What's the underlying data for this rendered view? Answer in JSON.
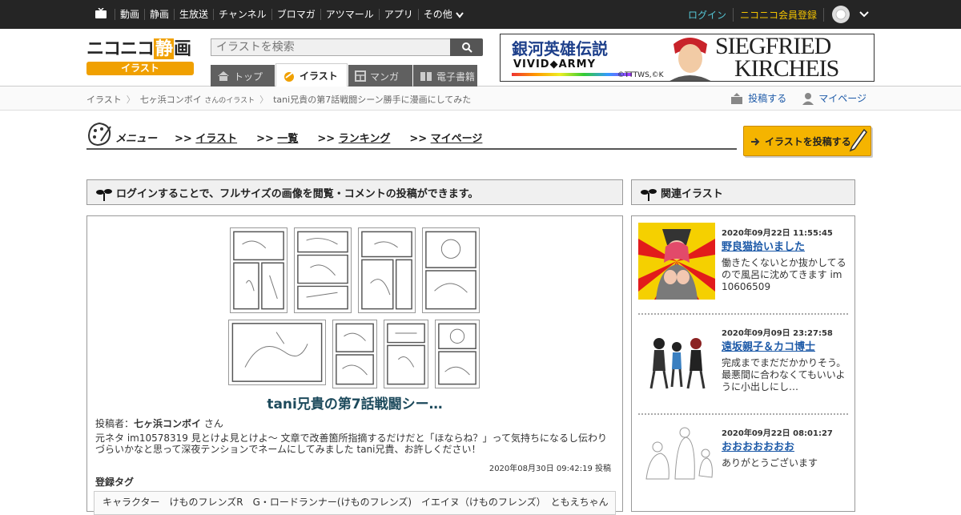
{
  "topbar": {
    "nav": [
      "動画",
      "静画",
      "生放送",
      "チャンネル",
      "ブロマガ",
      "アツマール",
      "アプリ",
      "その他"
    ],
    "login": "ログイン",
    "register": "ニコニコ会員登録"
  },
  "header": {
    "logo_main": "ニコニコ",
    "logo_sei": "静",
    "logo_ga": "画",
    "logo_sub": "イラスト",
    "search_placeholder": "イラストを検索",
    "tabs": [
      "トップ",
      "イラスト",
      "マンガ",
      "電子書籍"
    ],
    "banner": {
      "title": "銀河英雄伝説",
      "sub": "VIVID◆ARMY",
      "name1": "SIEGFRIED",
      "name2": "KIRCHEIS",
      "copy": "©TTTWS,©K"
    }
  },
  "breadcrumb": {
    "items": [
      "イラスト",
      "七ヶ浜コンボイ",
      "tani兄貴の第7話戦闘シーン勝手に漫画にしてみた"
    ],
    "author_suffix": "さんのイラスト",
    "post": "投稿する",
    "mypage": "マイページ"
  },
  "menu": {
    "label": "メニュー",
    "links": [
      "イラスト",
      "一覧",
      "ランキング",
      "マイページ"
    ],
    "post_button": "イラストを投稿する"
  },
  "main": {
    "notice": "ログインすることで、フルサイズの画像を閲覧・コメントの投稿ができます。",
    "title": "tani兄貴の第7話戦闘シー…",
    "poster_label": "投稿者：",
    "poster": "七ヶ浜コンボイ",
    "poster_suffix": " さん",
    "description": "元ネタ im10578319 見とけよ見とけよ～ 文章で改善箇所指摘するだけだと「ほならね？」って気持ちになるし伝わりづらいかなと思って深夜テンションでネームにしてみました tani兄貴、お許しください！",
    "date": "2020年08月30日 09:42:19 投稿",
    "tags_heading": "登録タグ",
    "tags": "キャラクター　けものフレンズR　G・ロードランナー(けものフレンズ)　イエイヌ（けものフレンズ）　ともえちゃん"
  },
  "related": {
    "heading": "関連イラスト",
    "items": [
      {
        "date": "2020年09月22日 11:55:45",
        "title": "野良猫拾いました",
        "desc": "働きたくないとか抜かしてるので風呂に沈めてきます im10606509"
      },
      {
        "date": "2020年09月09日 23:27:58",
        "title": "遠坂親子＆カコ博士",
        "desc": "完成までまだだかかりそう。最悪間に合わなくてもいいように小出しにし…"
      },
      {
        "date": "2020年09月22日 08:01:27",
        "title": "おおおおおおお",
        "desc": "ありがとうございます"
      }
    ]
  }
}
